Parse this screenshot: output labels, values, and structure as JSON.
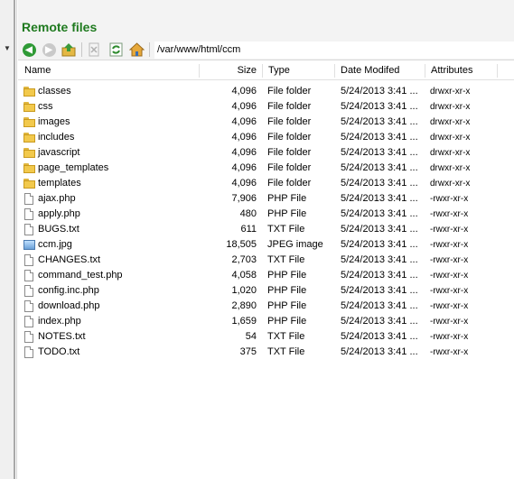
{
  "panel": {
    "title": "Remote files"
  },
  "toolbar": {
    "path": "/var/www/html/ccm",
    "buttons": [
      "back-icon",
      "forward-icon",
      "upload-icon",
      "delete-icon",
      "refresh-icon",
      "home-icon"
    ]
  },
  "columns": {
    "name": "Name",
    "size": "Size",
    "type": "Type",
    "date": "Date Modifed",
    "attr": "Attributes"
  },
  "files": [
    {
      "icon": "folder-icon",
      "name": "classes",
      "size": "4,096",
      "type": "File folder",
      "date": "5/24/2013 3:41 ...",
      "attr": "drwxr-xr-x"
    },
    {
      "icon": "folder-icon",
      "name": "css",
      "size": "4,096",
      "type": "File folder",
      "date": "5/24/2013 3:41 ...",
      "attr": "drwxr-xr-x"
    },
    {
      "icon": "folder-icon",
      "name": "images",
      "size": "4,096",
      "type": "File folder",
      "date": "5/24/2013 3:41 ...",
      "attr": "drwxr-xr-x"
    },
    {
      "icon": "folder-icon",
      "name": "includes",
      "size": "4,096",
      "type": "File folder",
      "date": "5/24/2013 3:41 ...",
      "attr": "drwxr-xr-x"
    },
    {
      "icon": "folder-icon",
      "name": "javascript",
      "size": "4,096",
      "type": "File folder",
      "date": "5/24/2013 3:41 ...",
      "attr": "drwxr-xr-x"
    },
    {
      "icon": "folder-icon",
      "name": "page_templates",
      "size": "4,096",
      "type": "File folder",
      "date": "5/24/2013 3:41 ...",
      "attr": "drwxr-xr-x"
    },
    {
      "icon": "folder-icon",
      "name": "templates",
      "size": "4,096",
      "type": "File folder",
      "date": "5/24/2013 3:41 ...",
      "attr": "drwxr-xr-x"
    },
    {
      "icon": "file-icon",
      "name": "ajax.php",
      "size": "7,906",
      "type": "PHP File",
      "date": "5/24/2013 3:41 ...",
      "attr": "-rwxr-xr-x"
    },
    {
      "icon": "file-icon",
      "name": "apply.php",
      "size": "480",
      "type": "PHP File",
      "date": "5/24/2013 3:41 ...",
      "attr": "-rwxr-xr-x"
    },
    {
      "icon": "file-icon",
      "name": "BUGS.txt",
      "size": "611",
      "type": "TXT File",
      "date": "5/24/2013 3:41 ...",
      "attr": "-rwxr-xr-x"
    },
    {
      "icon": "image-icon",
      "name": "ccm.jpg",
      "size": "18,505",
      "type": "JPEG image",
      "date": "5/24/2013 3:41 ...",
      "attr": "-rwxr-xr-x"
    },
    {
      "icon": "file-icon",
      "name": "CHANGES.txt",
      "size": "2,703",
      "type": "TXT File",
      "date": "5/24/2013 3:41 ...",
      "attr": "-rwxr-xr-x"
    },
    {
      "icon": "file-icon",
      "name": "command_test.php",
      "size": "4,058",
      "type": "PHP File",
      "date": "5/24/2013 3:41 ...",
      "attr": "-rwxr-xr-x"
    },
    {
      "icon": "file-icon",
      "name": "config.inc.php",
      "size": "1,020",
      "type": "PHP File",
      "date": "5/24/2013 3:41 ...",
      "attr": "-rwxr-xr-x"
    },
    {
      "icon": "file-icon",
      "name": "download.php",
      "size": "2,890",
      "type": "PHP File",
      "date": "5/24/2013 3:41 ...",
      "attr": "-rwxr-xr-x"
    },
    {
      "icon": "file-icon",
      "name": "index.php",
      "size": "1,659",
      "type": "PHP File",
      "date": "5/24/2013 3:41 ...",
      "attr": "-rwxr-xr-x"
    },
    {
      "icon": "file-icon",
      "name": "NOTES.txt",
      "size": "54",
      "type": "TXT File",
      "date": "5/24/2013 3:41 ...",
      "attr": "-rwxr-xr-x"
    },
    {
      "icon": "file-icon",
      "name": "TODO.txt",
      "size": "375",
      "type": "TXT File",
      "date": "5/24/2013 3:41 ...",
      "attr": "-rwxr-xr-x"
    }
  ]
}
